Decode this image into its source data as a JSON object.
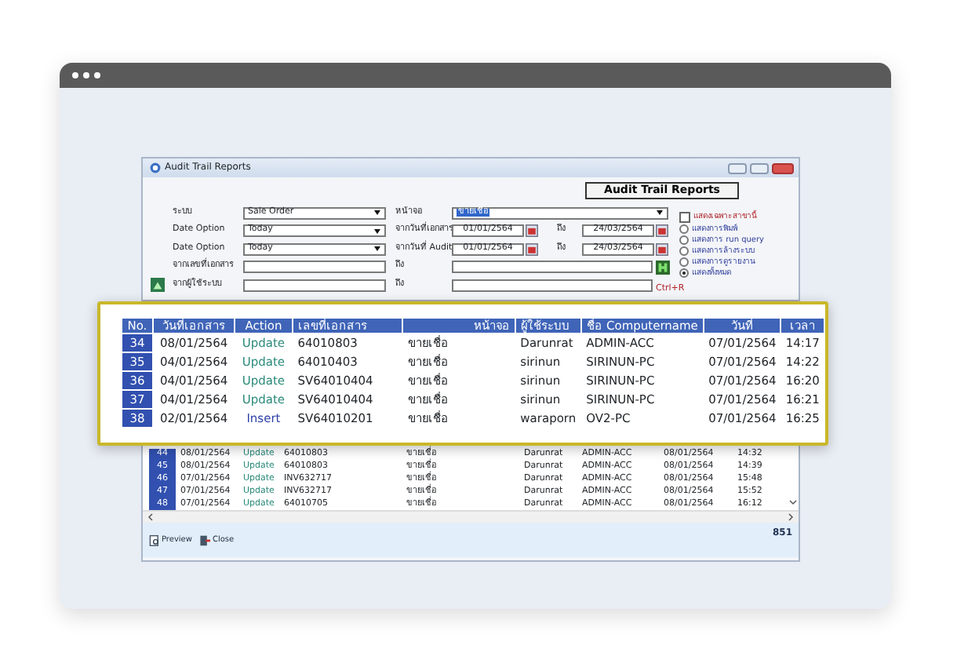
{
  "window": {
    "title": "Audit Trail Reports"
  },
  "report_button": "Audit Trail Reports",
  "filters": [
    {
      "items": [
        {
          "kind": "label",
          "text": "ระบบ"
        },
        {
          "kind": "combo",
          "value": "Sale Order"
        },
        {
          "kind": "label",
          "text": "หน้าจอ"
        },
        {
          "kind": "combo_wide",
          "value": "ขายเชื่อ",
          "selected": true
        }
      ]
    },
    {
      "items": [
        {
          "kind": "label",
          "text": "Date Option"
        },
        {
          "kind": "combo",
          "value": "Today"
        },
        {
          "kind": "label",
          "text": "จากวันที่เอกสาร"
        },
        {
          "kind": "date",
          "value": "01/01/2564"
        },
        {
          "kind": "to",
          "text": "ถึง"
        },
        {
          "kind": "date",
          "value": "24/03/2564"
        }
      ]
    },
    {
      "items": [
        {
          "kind": "label",
          "text": "Date Option"
        },
        {
          "kind": "combo",
          "value": "Today"
        },
        {
          "kind": "label",
          "text": "จากวันที่ Audit"
        },
        {
          "kind": "date",
          "value": "01/01/2564"
        },
        {
          "kind": "to",
          "text": "ถึง"
        },
        {
          "kind": "date",
          "value": "24/03/2564"
        }
      ]
    },
    {
      "items": [
        {
          "kind": "label",
          "text": "จากเลขที่เอกสาร"
        },
        {
          "kind": "text"
        },
        {
          "kind": "label",
          "text": "ถึง"
        },
        {
          "kind": "text_wide"
        },
        {
          "kind": "run"
        }
      ]
    },
    {
      "items": [
        {
          "kind": "icon"
        },
        {
          "kind": "label",
          "text": "จากผู้ใช้ระบบ"
        },
        {
          "kind": "text"
        },
        {
          "kind": "label",
          "text": "ถึง"
        },
        {
          "kind": "text_wide"
        },
        {
          "kind": "shortcut",
          "text": "Ctrl+R"
        }
      ]
    }
  ],
  "options": {
    "checkbox": {
      "label": "แสดงเฉพาะสาขานี้",
      "checked": false
    },
    "radios": [
      {
        "label": "แสดงการพิมพ์",
        "selected": false
      },
      {
        "label": "แสดงการ run query",
        "selected": false
      },
      {
        "label": "แสดงการล้างระบบ",
        "selected": false
      },
      {
        "label": "แสดงการดูรายงาน",
        "selected": false
      },
      {
        "label": "แสดงทั้งหมด",
        "selected": true
      }
    ]
  },
  "list": {
    "rows": [
      {
        "no": "44",
        "doc_date": "08/01/2564",
        "action": "Update",
        "color": "#2a8a7a",
        "doc_no": "64010803",
        "screen": "ขายเชื่อ",
        "user": "Darunrat",
        "computer": "ADMIN-ACC",
        "date": "08/01/2564",
        "time": "14:32"
      },
      {
        "no": "45",
        "doc_date": "08/01/2564",
        "action": "Update",
        "color": "#2a8a7a",
        "doc_no": "64010803",
        "screen": "ขายเชื่อ",
        "user": "Darunrat",
        "computer": "ADMIN-ACC",
        "date": "08/01/2564",
        "time": "14:39"
      },
      {
        "no": "46",
        "doc_date": "07/01/2564",
        "action": "Update",
        "color": "#2a8a7a",
        "doc_no": "INV632717",
        "screen": "ขายเชื่อ",
        "user": "Darunrat",
        "computer": "ADMIN-ACC",
        "date": "08/01/2564",
        "time": "15:48"
      },
      {
        "no": "47",
        "doc_date": "07/01/2564",
        "action": "Update",
        "color": "#2a8a7a",
        "doc_no": "INV632717",
        "screen": "ขายเชื่อ",
        "user": "Darunrat",
        "computer": "ADMIN-ACC",
        "date": "08/01/2564",
        "time": "15:52"
      },
      {
        "no": "48",
        "doc_date": "07/01/2564",
        "action": "Update",
        "color": "#2a8a7a",
        "doc_no": "64010705",
        "screen": "ขายเชื่อ",
        "user": "Darunrat",
        "computer": "ADMIN-ACC",
        "date": "08/01/2564",
        "time": "16:12"
      }
    ]
  },
  "toolbar": {
    "preview": "Preview",
    "close": "Close",
    "count": "851"
  },
  "highlight": {
    "columns": [
      "No.",
      "วันที่เอกสาร",
      "Action",
      "เลขที่เอกสาร",
      "หน้าจอ",
      "ผู้ใช้ระบบ",
      "ชื่อ Computername",
      "วันที่",
      "เวลา"
    ],
    "rows": [
      {
        "no": "34",
        "doc_date": "08/01/2564",
        "action": "Update",
        "color": "#2a8a7a",
        "doc_no": "64010803",
        "screen": "ขายเชื่อ",
        "user": "Darunrat",
        "computer": "ADMIN-ACC",
        "date": "07/01/2564",
        "time": "14:17"
      },
      {
        "no": "35",
        "doc_date": "04/01/2564",
        "action": "Update",
        "color": "#2a8a7a",
        "doc_no": "64010403",
        "screen": "ขายเชื่อ",
        "user": "sirinun",
        "computer": "SIRINUN-PC",
        "date": "07/01/2564",
        "time": "14:22"
      },
      {
        "no": "36",
        "doc_date": "04/01/2564",
        "action": "Update",
        "color": "#2a8a7a",
        "doc_no": "SV64010404",
        "screen": "ขายเชื่อ",
        "user": "sirinun",
        "computer": "SIRINUN-PC",
        "date": "07/01/2564",
        "time": "16:20"
      },
      {
        "no": "37",
        "doc_date": "04/01/2564",
        "action": "Update",
        "color": "#2a8a7a",
        "doc_no": "SV64010404",
        "screen": "ขายเชื่อ",
        "user": "sirinun",
        "computer": "SIRINUN-PC",
        "date": "07/01/2564",
        "time": "16:21"
      },
      {
        "no": "38",
        "doc_date": "02/01/2564",
        "action": "Insert",
        "color": "#2b3fa8",
        "doc_no": "SV64010201",
        "screen": "ขายเชื่อ",
        "user": "waraporn",
        "computer": "OV2-PC",
        "date": "07/01/2564",
        "time": "16:25"
      }
    ]
  }
}
